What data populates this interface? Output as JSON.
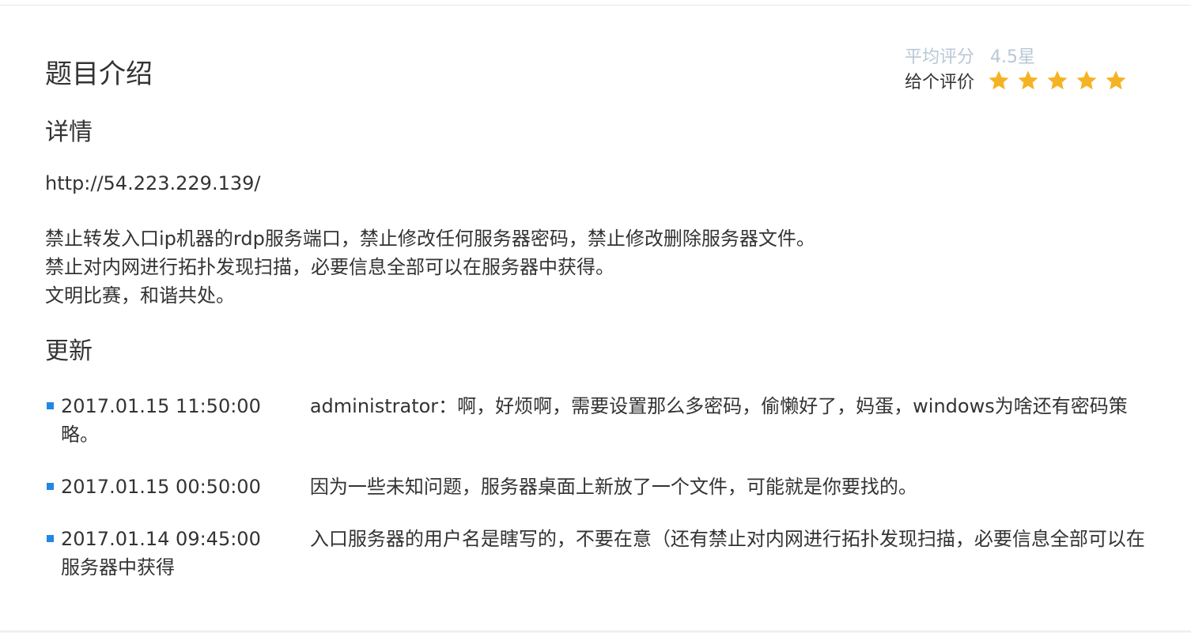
{
  "intro": {
    "title": "题目介绍"
  },
  "rating": {
    "avg_label": "平均评分",
    "avg_value": "4.5星",
    "give_label": "给个评价",
    "star_count": 5,
    "star_color": "#f5b324",
    "star_icon": "star-icon"
  },
  "details": {
    "heading": "详情",
    "url": "http://54.223.229.139/",
    "rules": [
      "禁止转发入口ip机器的rdp服务端口，禁止修改任何服务器密码，禁止修改删除服务器文件。",
      "禁止对内网进行拓扑发现扫描，必要信息全部可以在服务器中获得。",
      "文明比赛，和谐共处。"
    ]
  },
  "updates": {
    "heading": "更新",
    "bullet_color": "#1e88e5",
    "items": [
      {
        "time": "2017.01.15 11:50:00",
        "text": "administrator：啊，好烦啊，需要设置那么多密码，偷懒好了，妈蛋，windows为啥还有密码策略。"
      },
      {
        "time": "2017.01.15 00:50:00",
        "text": "因为一些未知问题，服务器桌面上新放了一个文件，可能就是你要找的。"
      },
      {
        "time": "2017.01.14 09:45:00",
        "text": "入口服务器的用户名是瞎写的，不要在意（还有禁止对内网进行拓扑发现扫描，必要信息全部可以在服务器中获得"
      }
    ]
  }
}
